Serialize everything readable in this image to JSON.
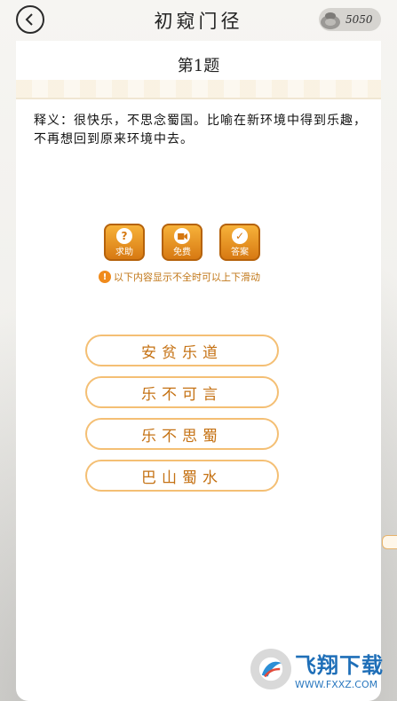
{
  "header": {
    "title": "初窥门径",
    "coin_count": "5050"
  },
  "question": {
    "number": "第1题",
    "definition": "释义：很快乐，不思念蜀国。比喻在新环境中得到乐趣，不再想回到原来环境中去。"
  },
  "actions": [
    {
      "label": "求助",
      "icon": "question-icon"
    },
    {
      "label": "免费",
      "icon": "video-icon"
    },
    {
      "label": "答案",
      "icon": "check-icon"
    }
  ],
  "hint": "以下内容显示不全时可以上下滑动",
  "options": [
    "安贫乐道",
    "乐不可言",
    "乐不思蜀",
    "巴山蜀水"
  ],
  "watermark": {
    "name": "飞翔下载",
    "url": "WWW.FXXZ.COM"
  },
  "colors": {
    "accent": "#f4bf74",
    "button": "#e0861a",
    "option_text": "#c57214"
  }
}
